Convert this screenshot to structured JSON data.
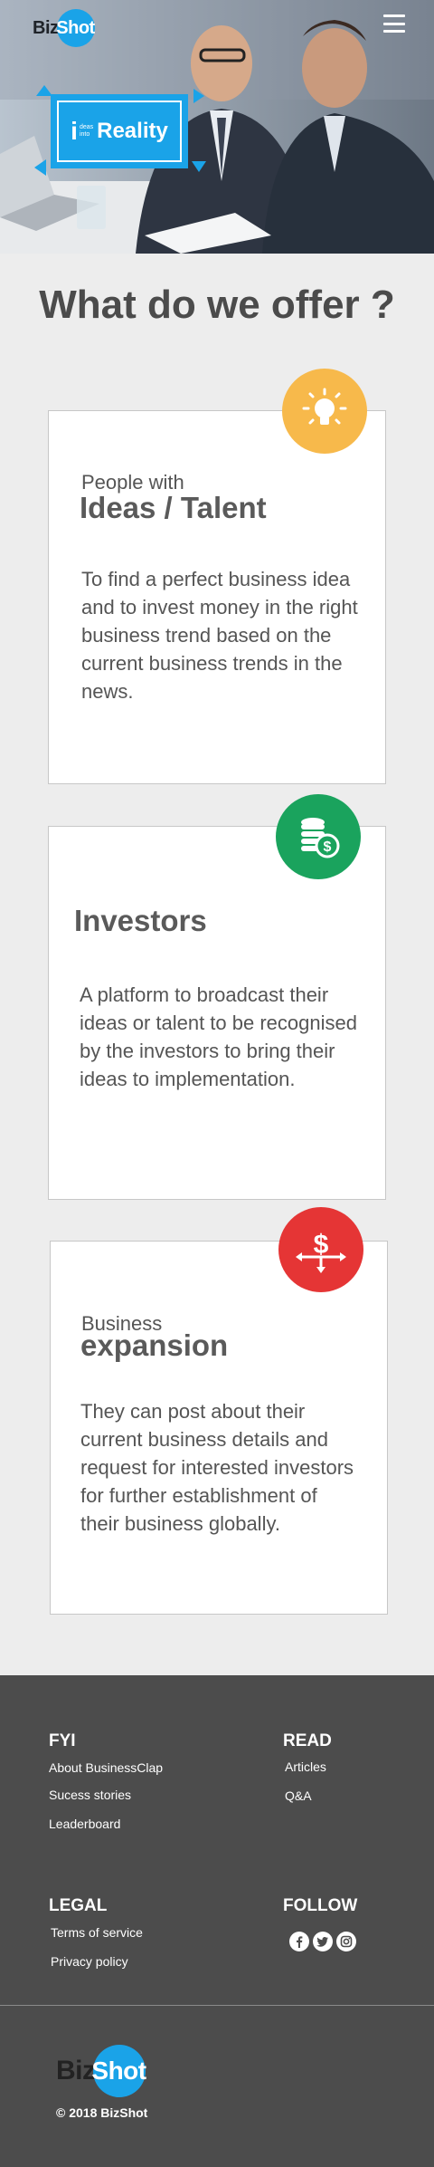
{
  "header": {
    "logo_part1": "Biz",
    "logo_part2": "Shot"
  },
  "hero": {
    "badge_letter": "i",
    "badge_small_1": "deas",
    "badge_small_2": "into",
    "badge_text": "Reality"
  },
  "offer": {
    "title": "What do we offer ?",
    "cards": [
      {
        "pre": "People with",
        "heading": "Ideas / Talent",
        "description": "To find a perfect business idea and to invest money in the right business trend based on the current business trends in the news.",
        "icon": "lightbulb-icon",
        "color": "#f7b94b"
      },
      {
        "pre": "",
        "heading": "Investors",
        "description": "A platform to broadcast their ideas or talent to be recognised by the investors to bring their ideas to implementation.",
        "icon": "coins-icon",
        "color": "#1aa35d"
      },
      {
        "pre": "Business",
        "heading": "expansion",
        "description": "They can post about their current business details and request for interested investors for further establishment of their business globally.",
        "icon": "dollar-expansion-icon",
        "color": "#e53535"
      }
    ]
  },
  "footer": {
    "fyi": {
      "heading": "FYI",
      "links": [
        "About BusinessClap",
        "Sucess stories",
        "Leaderboard"
      ]
    },
    "read": {
      "heading": "READ",
      "links": [
        "Articles",
        "Q&A"
      ]
    },
    "legal": {
      "heading": "LEGAL",
      "links": [
        "Terms of service",
        "Privacy policy"
      ]
    },
    "follow": {
      "heading": "FOLLOW",
      "icons": [
        "facebook-icon",
        "twitter-icon",
        "instagram-icon"
      ]
    },
    "logo_part1": "Biz",
    "logo_part2": "Shot",
    "copyright": "© 2018 BizShot"
  },
  "colors": {
    "brand_blue": "#1aa3e8",
    "footer_bg": "#4c4c4c",
    "page_bg": "#ededed"
  }
}
